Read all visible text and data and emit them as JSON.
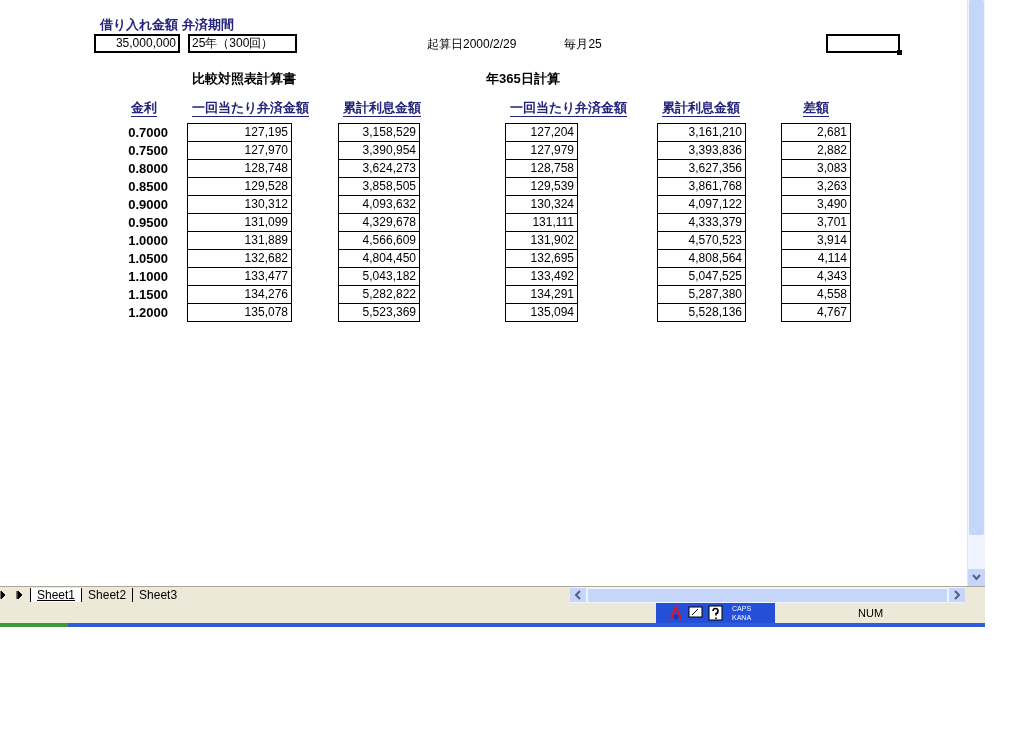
{
  "inputs": {
    "loan_label": "借り入れ金額",
    "term_label": "弁済期間",
    "loan_amount": "35,000,000",
    "term": "25年（300回）",
    "start_date": "起算日2000/2/29",
    "payment_day": "毎月25"
  },
  "titles": {
    "left": "比較対照表計算書",
    "right": "年365日計算"
  },
  "columns": [
    "金利",
    "一回当たり弁済金額",
    "累計利息金額",
    "一回当たり弁済金額",
    "累計利息金額",
    "差額"
  ],
  "rows": [
    [
      "0.7000",
      "127,195",
      "3,158,529",
      "127,204",
      "3,161,210",
      "2,681"
    ],
    [
      "0.7500",
      "127,970",
      "3,390,954",
      "127,979",
      "3,393,836",
      "2,882"
    ],
    [
      "0.8000",
      "128,748",
      "3,624,273",
      "128,758",
      "3,627,356",
      "3,083"
    ],
    [
      "0.8500",
      "129,528",
      "3,858,505",
      "129,539",
      "3,861,768",
      "3,263"
    ],
    [
      "0.9000",
      "130,312",
      "4,093,632",
      "130,324",
      "4,097,122",
      "3,490"
    ],
    [
      "0.9500",
      "131,099",
      "4,329,678",
      "131,111",
      "4,333,379",
      "3,701"
    ],
    [
      "1.0000",
      "131,889",
      "4,566,609",
      "131,902",
      "4,570,523",
      "3,914"
    ],
    [
      "1.0500",
      "132,682",
      "4,804,450",
      "132,695",
      "4,808,564",
      "4,114"
    ],
    [
      "1.1000",
      "133,477",
      "5,043,182",
      "133,492",
      "5,047,525",
      "4,343"
    ],
    [
      "1.1500",
      "134,276",
      "5,282,822",
      "134,291",
      "5,287,380",
      "4,558"
    ],
    [
      "1.2000",
      "135,078",
      "5,523,369",
      "135,094",
      "5,528,136",
      "4,767"
    ]
  ],
  "sheet_tabs": [
    {
      "label": "Sheet1",
      "selected": true
    },
    {
      "label": "Sheet2",
      "selected": false
    },
    {
      "label": "Sheet3",
      "selected": false
    }
  ],
  "language_bar": {
    "caps": "CAPS",
    "kana": "KANA"
  },
  "status_bar": {
    "num": "NUM"
  }
}
